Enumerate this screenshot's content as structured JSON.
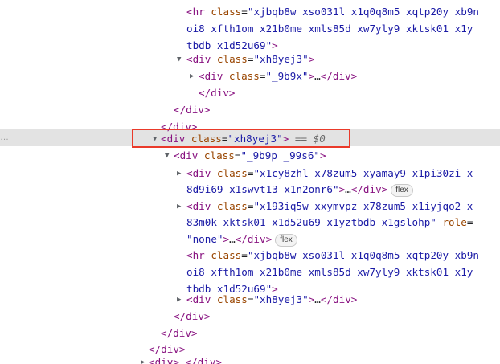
{
  "gutter_ellipsis": "…",
  "lines": [
    {
      "tag": "hr",
      "kind": "open_attr",
      "parts": [
        [
          "t",
          "<hr "
        ],
        [
          "a",
          "class"
        ],
        [
          "p",
          "="
        ],
        [
          "v",
          "\"xjbqb8w xso031l x1q0q8m5 xqtp20y xb9n"
        ]
      ]
    },
    {
      "kind": "cont",
      "parts": [
        [
          "v",
          "oi8 xfth1om x21b0me xmls85d xw7yly9 xktsk01 x1y"
        ]
      ]
    },
    {
      "kind": "cont",
      "parts": [
        [
          "v",
          "tbdb x1d52u69\""
        ],
        [
          "t",
          ">"
        ]
      ]
    },
    {
      "kind": "open",
      "parts": [
        [
          "t",
          "<div "
        ],
        [
          "a",
          "class"
        ],
        [
          "p",
          "="
        ],
        [
          "v",
          "\"xh8yej3\""
        ],
        [
          "t",
          ">"
        ]
      ]
    },
    {
      "kind": "collapsed",
      "parts": [
        [
          "t",
          "<div "
        ],
        [
          "a",
          "class"
        ],
        [
          "p",
          "="
        ],
        [
          "v",
          "\"_9b9x\""
        ],
        [
          "t",
          ">"
        ],
        [
          "p",
          "…"
        ],
        [
          "t",
          "</div>"
        ]
      ]
    },
    {
      "kind": "close",
      "parts": [
        [
          "t",
          "</div>"
        ]
      ]
    },
    {
      "kind": "close",
      "parts": [
        [
          "t",
          "</div>"
        ]
      ]
    },
    {
      "kind": "close",
      "parts": [
        [
          "t",
          "</div>"
        ]
      ]
    },
    {
      "kind": "selected",
      "parts": [
        [
          "t",
          "<div "
        ],
        [
          "a",
          "class"
        ],
        [
          "p",
          "="
        ],
        [
          "v",
          "\"xh8yej3\""
        ],
        [
          "t",
          ">"
        ],
        [
          "p",
          " "
        ],
        [
          "dim",
          "== $0"
        ]
      ]
    },
    {
      "kind": "open",
      "parts": [
        [
          "t",
          "<div "
        ],
        [
          "a",
          "class"
        ],
        [
          "p",
          "="
        ],
        [
          "v",
          "\"_9b9p _99s6\""
        ],
        [
          "t",
          ">"
        ]
      ]
    },
    {
      "kind": "collapsed",
      "parts": [
        [
          "t",
          "<div "
        ],
        [
          "a",
          "class"
        ],
        [
          "p",
          "="
        ],
        [
          "v",
          "\"x1cy8zhl x78zum5 xyamay9 x1pi30zi x"
        ]
      ]
    },
    {
      "kind": "cont",
      "parts": [
        [
          "v",
          "8d9i69 x1swvt13 x1n2onr6\""
        ],
        [
          "t",
          ">"
        ],
        [
          "p",
          "…"
        ],
        [
          "t",
          "</div>"
        ]
      ],
      "badge": "flex"
    },
    {
      "kind": "collapsed",
      "parts": [
        [
          "t",
          "<div "
        ],
        [
          "a",
          "class"
        ],
        [
          "p",
          "="
        ],
        [
          "v",
          "\"x193iq5w xxymvpz x78zum5 x1iyjqo2 x"
        ]
      ]
    },
    {
      "kind": "cont",
      "parts": [
        [
          "v",
          "83m0k xktsk01 x1d52u69 x1yztbdb x1gslohp\""
        ],
        [
          "p",
          " "
        ],
        [
          "a",
          "role"
        ],
        [
          "p",
          "="
        ]
      ]
    },
    {
      "kind": "cont",
      "parts": [
        [
          "v",
          "\"none\""
        ],
        [
          "t",
          ">"
        ],
        [
          "p",
          "…"
        ],
        [
          "t",
          "</div>"
        ]
      ],
      "badge": "flex"
    },
    {
      "kind": "open_attr",
      "parts": [
        [
          "t",
          "<hr "
        ],
        [
          "a",
          "class"
        ],
        [
          "p",
          "="
        ],
        [
          "v",
          "\"xjbqb8w xso031l x1q0q8m5 xqtp20y xb9n"
        ]
      ]
    },
    {
      "kind": "cont",
      "parts": [
        [
          "v",
          "oi8 xfth1om x21b0me xmls85d xw7yly9 xktsk01 x1y"
        ]
      ]
    },
    {
      "kind": "cont",
      "parts": [
        [
          "v",
          "tbdb x1d52u69\""
        ],
        [
          "t",
          ">"
        ]
      ]
    },
    {
      "kind": "collapsed",
      "parts": [
        [
          "t",
          "<div "
        ],
        [
          "a",
          "class"
        ],
        [
          "p",
          "="
        ],
        [
          "v",
          "\"xh8yej3\""
        ],
        [
          "t",
          ">"
        ],
        [
          "p",
          "…"
        ],
        [
          "t",
          "</div>"
        ]
      ]
    },
    {
      "kind": "close",
      "parts": [
        [
          "t",
          "</div>"
        ]
      ]
    },
    {
      "kind": "close",
      "parts": [
        [
          "t",
          "</div>"
        ]
      ]
    },
    {
      "kind": "close",
      "parts": [
        [
          "t",
          "</div>"
        ]
      ]
    },
    {
      "kind": "collapsed",
      "parts": [
        [
          "t",
          "<div>"
        ],
        [
          "p",
          "…"
        ],
        [
          "t",
          "</div>"
        ]
      ]
    }
  ]
}
